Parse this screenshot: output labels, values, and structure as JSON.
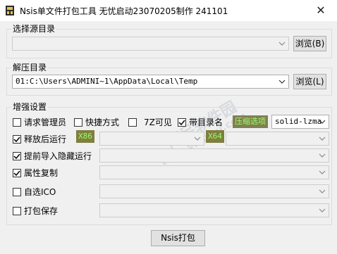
{
  "window": {
    "title": "Nsis单文件打包工具 无忧启动23070205制作 241101",
    "close_glyph": "✕"
  },
  "source_group": {
    "title": "选择源目录",
    "path_value": "",
    "browse_label": "浏览(B)"
  },
  "extract_group": {
    "title": "解压目录",
    "path_value": "01:C:\\Users\\ADMINI~1\\AppData\\Local\\Temp",
    "browse_label": "浏览(L)"
  },
  "enhance_group": {
    "title": "增强设置",
    "options_row": [
      {
        "label": "请求管理员",
        "checked": false
      },
      {
        "label": "快捷方式",
        "checked": false
      },
      {
        "label": "7Z可见",
        "checked": false
      },
      {
        "label": "带目录名",
        "checked": true
      }
    ],
    "compress_label": "压缩选项",
    "compress_value": "solid-lzma",
    "post_run": {
      "label": "释放后运行",
      "checked": true,
      "x86_tag": "X86",
      "x64_tag": "X64"
    },
    "pre_import": {
      "label": "提前导入隐藏运行",
      "checked": true
    },
    "attr_copy": {
      "label": "属性复制",
      "checked": true
    },
    "custom_ico": {
      "label": "自选ICO",
      "checked": false
    },
    "pack_save": {
      "label": "打包保存",
      "checked": false
    }
  },
  "pack_button_label": "Nsis打包",
  "watermark": {
    "site": "www.yanzhu.com",
    "name": "阿呆软件园"
  },
  "colors": {
    "tag_bg": "#7f7f3f",
    "tag_fg": "#99ff66",
    "compress_bg": "#808050"
  }
}
